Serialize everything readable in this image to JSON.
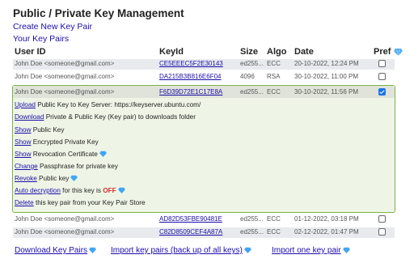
{
  "title": "Public / Private Key Management",
  "links": {
    "create": "Create New Key Pair",
    "your_keys": "Your Key Pairs"
  },
  "headers": {
    "user_id": "User ID",
    "key_id": "KeyId",
    "size": "Size",
    "algo": "Algo",
    "date": "Date",
    "pref": "Pref"
  },
  "rows": [
    {
      "user": "John Doe <someone@gmail.com>",
      "key": "CE5EEEC5F2E30143",
      "size": "ed255...",
      "algo": "ECC",
      "date": "20-10-2022, 12:24 PM",
      "pref": false
    },
    {
      "user": "John Doe <someone@gmail.com>",
      "key": "DA215B3B816E6F04",
      "size": "4096",
      "algo": "RSA",
      "date": "30-10-2022, 11:00 PM",
      "pref": false
    }
  ],
  "selected": {
    "user": "John Doe <someone@gmail.com>",
    "key": "F6D39D72E1C17E8A",
    "size": "ed255...",
    "algo": "ECC",
    "date": "30-10-2022, 11:56 PM",
    "pref": true
  },
  "actions": {
    "upload": {
      "link": "Upload",
      "text": " Public Key to Key Server: https://keyserver.ubuntu.com/"
    },
    "download": {
      "link": "Download",
      "text": " Private & Public Key (Key pair) to downloads folder"
    },
    "show_pub": {
      "link": "Show",
      "text": " Public Key"
    },
    "show_enc": {
      "link": "Show",
      "text": " Encrypted Private Key"
    },
    "show_rev": {
      "link": "Show",
      "text": " Revocation Certificate"
    },
    "change": {
      "link": "Change",
      "text": " Passphrase for private key"
    },
    "revoke": {
      "link": "Revoke",
      "text": " Public key"
    },
    "auto": {
      "link": "Auto decryption",
      "text": " for this key is ",
      "state": "OFF"
    },
    "delete": {
      "link": "Delete",
      "text": " this key pair from your Key Pair Store"
    }
  },
  "rows_after": [
    {
      "user": "John Doe <someone@gmail.com>",
      "key": "AD82D53FBE90481E",
      "size": "ed255...",
      "algo": "ECC",
      "date": "01-12-2022, 03:18 PM",
      "pref": false
    },
    {
      "user": "John Doe <someone@gmail.com>",
      "key": "C82D8509CEF4A87A",
      "size": "ed255...",
      "algo": "ECC",
      "date": "02-12-2022, 01:47 PM",
      "pref": false
    }
  ],
  "footer": {
    "download_all": "Download Key Pairs",
    "import_backup": "Import key pairs (back up of all keys)",
    "import_one": "Import one key pair"
  },
  "colors": {
    "link": "#1a0dab",
    "panel_border": "#7cb342",
    "panel_bg": "#eef5e6",
    "row_shade": "#e8eaed",
    "off": "#d32f2f",
    "gem": "#42a5f5"
  }
}
